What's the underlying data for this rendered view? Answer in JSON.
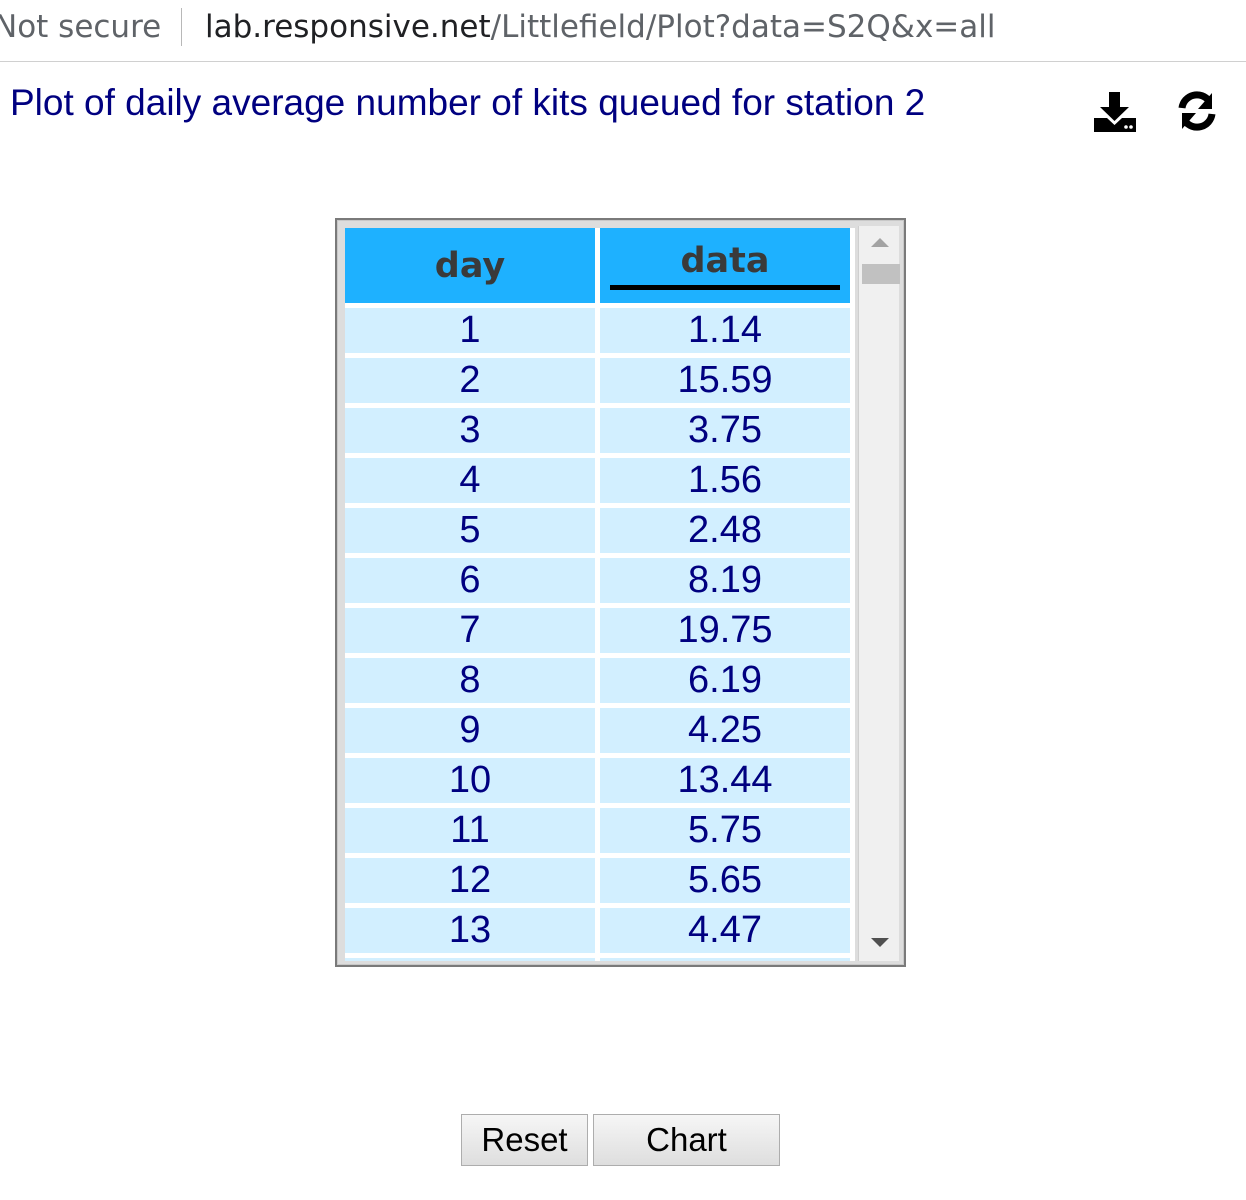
{
  "browser": {
    "security_label": "Not secure",
    "url_host": "lab.responsive.net",
    "url_path": "/Littlefield/Plot?data=S2Q&x=all"
  },
  "page": {
    "title": "Plot of daily average number of kits queued for station 2",
    "icons": [
      "download-icon",
      "refresh-icon"
    ]
  },
  "table": {
    "columns": [
      "day",
      "data"
    ],
    "sorted_column": "data",
    "rows": [
      [
        "1",
        "1.14"
      ],
      [
        "2",
        "15.59"
      ],
      [
        "3",
        "3.75"
      ],
      [
        "4",
        "1.56"
      ],
      [
        "5",
        "2.48"
      ],
      [
        "6",
        "8.19"
      ],
      [
        "7",
        "19.75"
      ],
      [
        "8",
        "6.19"
      ],
      [
        "9",
        "4.25"
      ],
      [
        "10",
        "13.44"
      ],
      [
        "11",
        "5.75"
      ],
      [
        "12",
        "5.65"
      ],
      [
        "13",
        "4.47"
      ]
    ]
  },
  "buttons": {
    "reset_label": "Reset",
    "chart_label": "Chart"
  },
  "colors": {
    "header_bg": "#1eb1ff",
    "cell_bg": "#d2efff",
    "text": "#000080"
  }
}
